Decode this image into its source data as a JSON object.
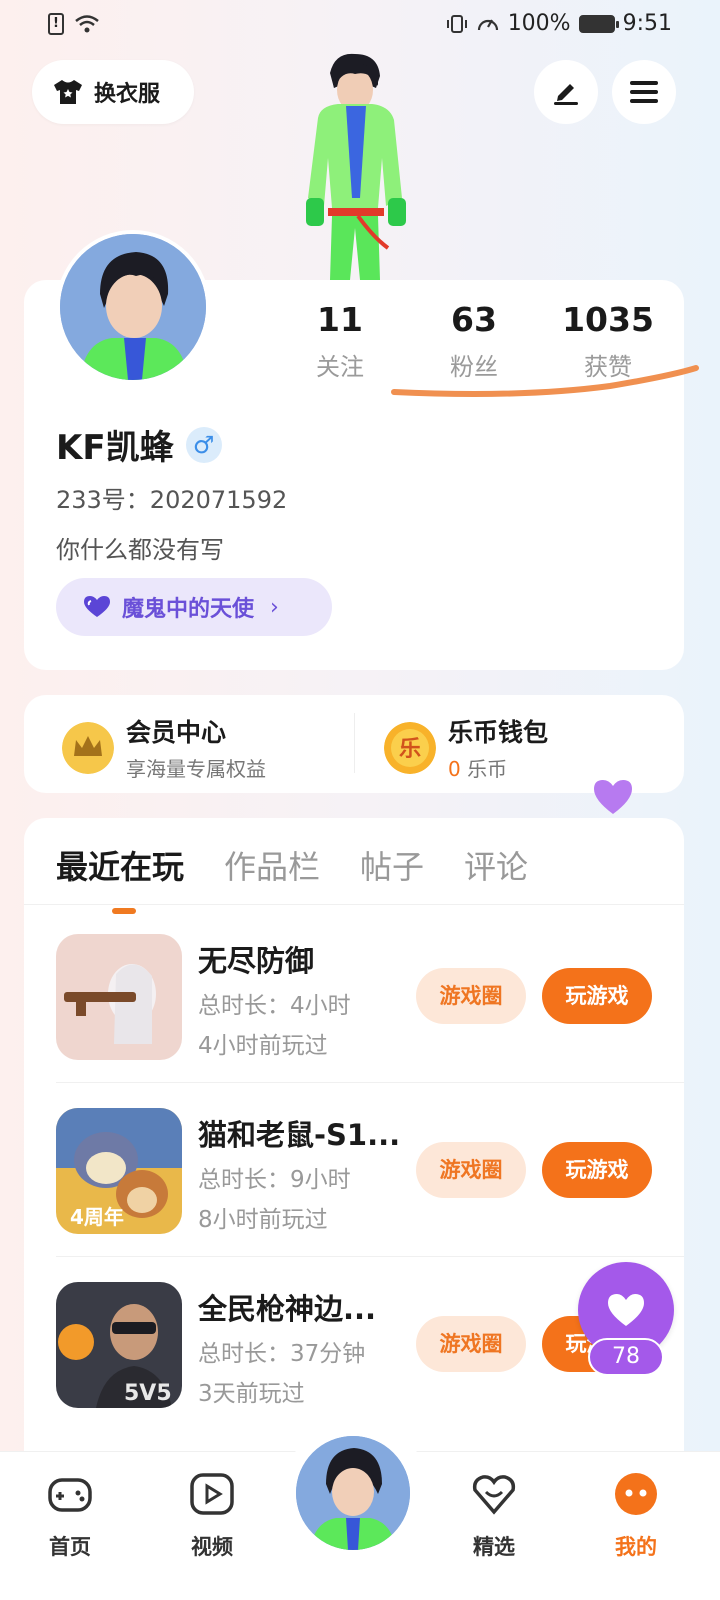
{
  "status_bar": {
    "battery": "100%",
    "time": "9:51"
  },
  "top": {
    "dress_label": "换衣服"
  },
  "profile": {
    "stats": [
      {
        "value": "11",
        "label": "关注"
      },
      {
        "value": "63",
        "label": "粉丝"
      },
      {
        "value": "1035",
        "label": "获赞"
      }
    ],
    "username": "KF凯蜂",
    "gender_symbol": "♂",
    "uid": "233号：202071592",
    "bio": "你什么都没有写",
    "tag": "魔鬼中的天使"
  },
  "member": {
    "title": "会员中心",
    "subtitle": "享海量专属权益"
  },
  "wallet": {
    "title": "乐币钱包",
    "amount": "0",
    "unit": "乐币",
    "icon_char": "乐"
  },
  "tabs": [
    "最近在玩",
    "作品栏",
    "帖子",
    "评论"
  ],
  "games": [
    {
      "name": "无尽防御",
      "duration": "总时长：4小时",
      "last_played": "4小时前玩过",
      "circle_btn": "游戏圈",
      "play_btn": "玩游戏"
    },
    {
      "name": "猫和老鼠-S1...",
      "duration": "总时长：9小时",
      "last_played": "8小时前玩过",
      "circle_btn": "游戏圈",
      "play_btn": "玩游戏"
    },
    {
      "name": "全民枪神边...",
      "duration": "总时长：37分钟",
      "last_played": "3天前玩过",
      "circle_btn": "游戏圈",
      "play_btn": "玩游戏"
    }
  ],
  "float_like_count": "78",
  "nav": [
    "首页",
    "视频",
    "精选",
    "我的"
  ],
  "colors": {
    "accent": "#f4721a",
    "purple": "#a459ea",
    "tag_text": "#6a50d8"
  }
}
